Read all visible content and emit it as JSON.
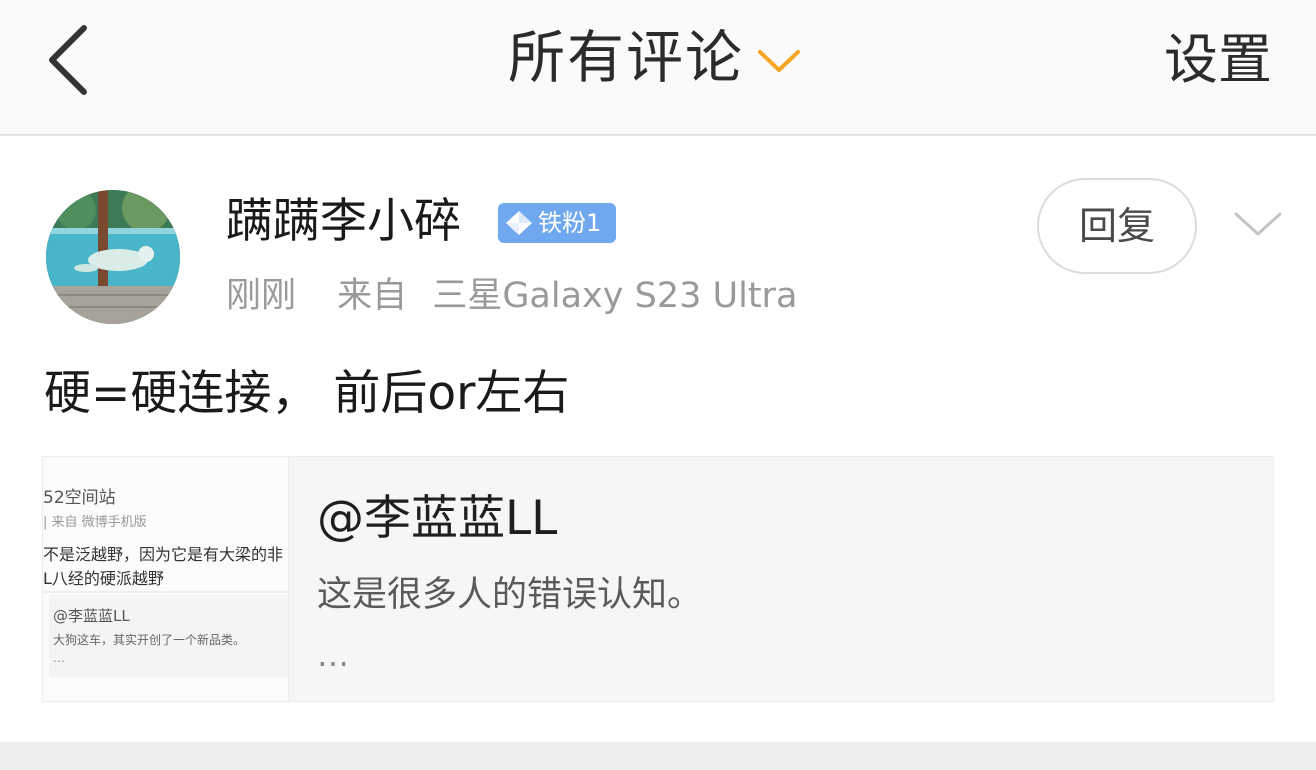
{
  "header": {
    "title": "所有评论",
    "settings_label": "设置",
    "accent_color": "#f5a623",
    "back_icon": "chevron-left-icon",
    "filter_icon": "chevron-down-icon"
  },
  "comment": {
    "username": "蹒蹒李小碎",
    "badge_label": "铁粉1",
    "badge_color": "#6fa8ef",
    "time": "刚刚",
    "source_prefix": "来自",
    "source_device": "三星Galaxy S23 Ultra",
    "reply_label": "回复",
    "more_icon": "chevron-down-icon",
    "text": "硬=硬连接， 前后or左右"
  },
  "quote": {
    "title": "@李蓝蓝LL",
    "body": "这是很多人的错误认知。",
    "ellipsis": "…",
    "thumbnail": {
      "line1": "52空间站",
      "line2": "| 来自 微博手机版",
      "line3": "不是泛越野，因为它是有大梁的非",
      "line4": "L八经的硬派越野",
      "line5": "@李蓝蓝LL",
      "line6": "大狗这车，其实开创了一个新品类。",
      "line7": "…"
    }
  }
}
